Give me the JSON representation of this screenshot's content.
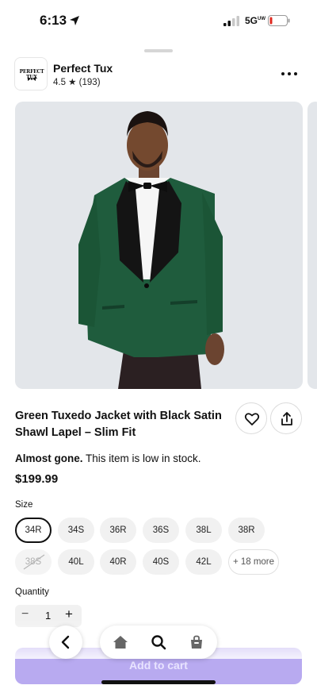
{
  "status_bar": {
    "time": "6:13",
    "network": "5G",
    "network_superscript": "UW",
    "icons": [
      "location-arrow-icon",
      "signal-icon",
      "battery-low-icon"
    ]
  },
  "shop": {
    "logo_text": "PERFECT TUX",
    "name": "Perfect Tux",
    "rating": "4.5 ★ (193)"
  },
  "product": {
    "title": "Green Tuxedo Jacket with Black Satin Shawl Lapel – Slim Fit",
    "stock_bold": "Almost gone.",
    "stock_text": " This item is low in stock.",
    "price": "$199.99",
    "image_alt": "man wearing a green tuxedo jacket with black satin shawl lapel and black bow tie"
  },
  "sizes": {
    "label": "Size",
    "options": [
      "34R",
      "34S",
      "36R",
      "36S",
      "38L",
      "38R",
      "38S",
      "40L",
      "40R",
      "40S",
      "42L"
    ],
    "selected": "34R",
    "unavailable": [
      "38S"
    ],
    "more": "+ 18 more"
  },
  "quantity": {
    "label": "Quantity",
    "value": "1",
    "minus": "−",
    "plus": "+"
  },
  "cart": {
    "label": "Add to cart"
  },
  "colors": {
    "jacket": "#1f5c3d",
    "cart_button": "#b8aaf0",
    "photo_background": "#e3e6ea"
  },
  "icons": {
    "more": "more-dots-icon",
    "favorite": "heart-icon",
    "share": "share-icon",
    "back": "chevron-left-icon",
    "home": "home-icon",
    "search": "search-icon",
    "bag": "bag-icon"
  }
}
